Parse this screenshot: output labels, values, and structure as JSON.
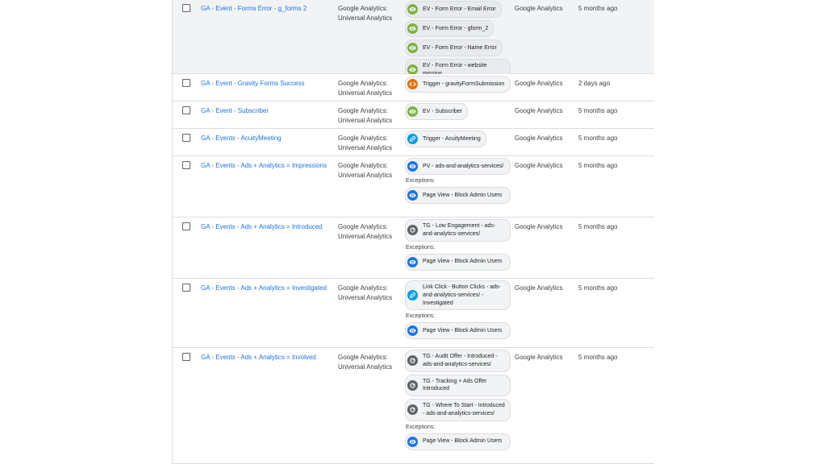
{
  "rows": [
    {
      "name": "GA - Event - Forms Error - g_forms 2",
      "type": "Google Analytics: Universal Analytics",
      "triggers": [
        {
          "label": "EV - Form Error - Email Error",
          "icon": "eye-icon"
        },
        {
          "label": "EV - Form Error - gform_2",
          "icon": "eye-icon"
        },
        {
          "label": "EV - Form Error - Name Error",
          "icon": "eye-icon"
        },
        {
          "label": "EV - Form Error - website missing",
          "icon": "eye-icon"
        }
      ],
      "destination": "Google Analytics",
      "edited": "5 months ago"
    },
    {
      "name": "GA - Event - Gravity Forms Success",
      "type": "Google Analytics: Universal Analytics",
      "triggers": [
        {
          "label": "Trigger - gravityFormSubmission",
          "icon": "code-icon"
        }
      ],
      "destination": "Google Analytics",
      "edited": "2 days ago"
    },
    {
      "name": "GA - Event - Subscriber",
      "type": "Google Analytics: Universal Analytics",
      "triggers": [
        {
          "label": "EV - Subscriber",
          "icon": "eye-icon"
        }
      ],
      "destination": "Google Analytics",
      "edited": "5 months ago"
    },
    {
      "name": "GA - Events - AcuityMeeting",
      "type": "Google Analytics: Universal Analytics",
      "triggers": [
        {
          "label": "Trigger - AcuityMeeting",
          "icon": "link-icon"
        }
      ],
      "destination": "Google Analytics",
      "edited": "5 months ago"
    },
    {
      "name": "GA - Events - Ads + Analytics = Impressions",
      "type": "Google Analytics: Universal Analytics",
      "triggers": [
        {
          "label": "PV - ads-and-analytics-services/",
          "icon": "eye-icon"
        }
      ],
      "exceptions_label": "Exceptions:",
      "exceptions": [
        {
          "label": "Page View - Block Admin Users",
          "icon": "eye-icon"
        }
      ],
      "destination": "Google Analytics",
      "edited": "5 months ago"
    },
    {
      "name": "GA - Events - Ads + Analytics = Introduced",
      "type": "Google Analytics: Universal Analytics",
      "triggers": [
        {
          "label": "TG - Low Engagement - ads-and-analytics-services/",
          "icon": "gear-icon"
        }
      ],
      "exceptions_label": "Exceptions:",
      "exceptions": [
        {
          "label": "Page View - Block Admin Users",
          "icon": "eye-icon"
        }
      ],
      "destination": "Google Analytics",
      "edited": "5 months ago"
    },
    {
      "name": "GA - Events - Ads + Analytics = Investigated",
      "type": "Google Analytics: Universal Analytics",
      "triggers": [
        {
          "label": "Link Click - Button Clicks - ads-and-analytics-services/ - Investigated",
          "icon": "link-icon"
        }
      ],
      "exceptions_label": "Exceptions:",
      "exceptions": [
        {
          "label": "Page View - Block Admin Users",
          "icon": "eye-icon"
        }
      ],
      "destination": "Google Analytics",
      "edited": "5 months ago"
    },
    {
      "name": "GA - Events - Ads + Analytics = Involved",
      "type": "Google Analytics: Universal Analytics",
      "triggers": [
        {
          "label": "TG - Audit Offer - Introduced - ads-and-analytics-services/",
          "icon": "gear-icon"
        },
        {
          "label": "TG - Tracking + Ads Offer Introduced",
          "icon": "gear-icon"
        },
        {
          "label": "TG - Where To Start - Introduced - ads-and-analytics-services/",
          "icon": "gear-icon"
        }
      ],
      "exceptions_label": "Exceptions:",
      "exceptions": [
        {
          "label": "Page View - Block Admin Users",
          "icon": "eye-icon"
        }
      ],
      "destination": "Google Analytics",
      "edited": "5 months ago"
    }
  ],
  "colors": {
    "link": "#1a73e8",
    "eye_green": "#7cb342",
    "eye_blue": "#1a73e8",
    "code_orange": "#e8710a",
    "gear_dark": "#5f6368",
    "row_highlight": "#f1f3f4"
  }
}
